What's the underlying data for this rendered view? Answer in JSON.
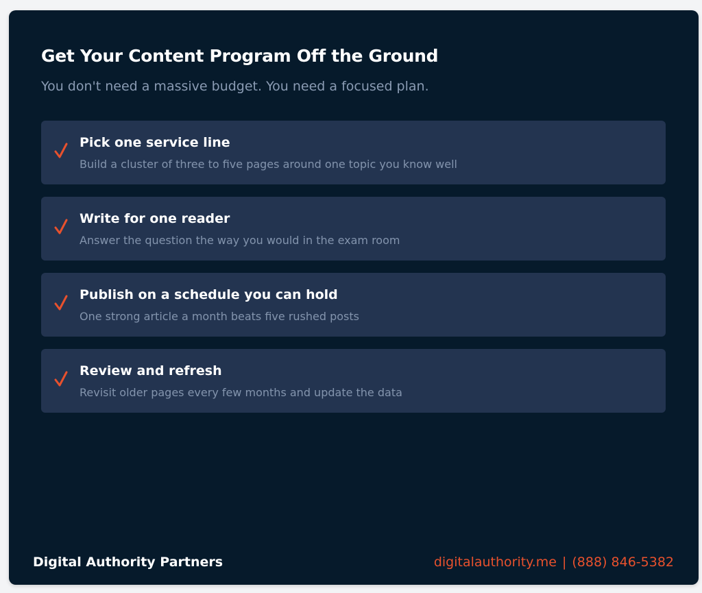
{
  "header": {
    "title": "Get Your Content Program Off the Ground",
    "subtitle": "You don't need a massive budget. You need a focused plan."
  },
  "steps": [
    {
      "icon": "check-icon",
      "title": "Pick one service line",
      "description": "Build a cluster of three to five pages around one topic you know well"
    },
    {
      "icon": "check-icon",
      "title": "Write for one reader",
      "description": "Answer the question the way you would in the exam room"
    },
    {
      "icon": "check-icon",
      "title": "Publish on a schedule you can hold",
      "description": "One strong article a month beats five rushed posts"
    },
    {
      "icon": "check-icon",
      "title": "Review and refresh",
      "description": "Revisit older pages every few months and update the data"
    }
  ],
  "footer": {
    "brand": "Digital Authority Partners",
    "website": "digitalauthority.me",
    "separator": "|",
    "phone": "(888) 846-5382"
  },
  "colors": {
    "card_background": "#061a2b",
    "step_background": "#233450",
    "accent": "#e8512d",
    "muted_text": "#8394ad",
    "page_background": "#f3f4f6"
  }
}
